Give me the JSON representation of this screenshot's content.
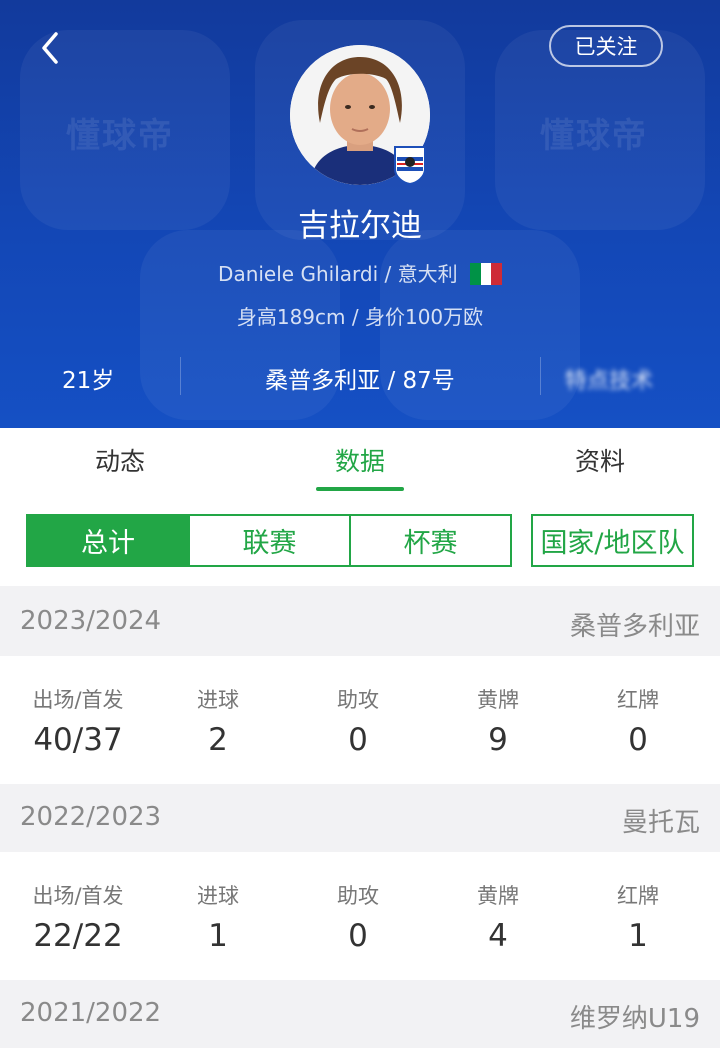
{
  "header": {
    "back_icon": "chevron-left-icon",
    "follow_label": "已关注",
    "watermark": "懂球帝",
    "player_name": "吉拉尔迪",
    "english_name": "Daniele Ghilardi",
    "nationality": "意大利",
    "flag_colors": [
      "#009246",
      "#ffffff",
      "#ce2b37"
    ],
    "height_value": "身高189cm / 身价100万欧",
    "age": "21岁",
    "club_number": "桑普多利亚 / 87号",
    "blurred_info": "特点技术"
  },
  "tabs": [
    {
      "label": "动态"
    },
    {
      "label": "数据",
      "active": true
    },
    {
      "label": "资料"
    }
  ],
  "segments": [
    {
      "label": "总计",
      "active": true
    },
    {
      "label": "联赛"
    },
    {
      "label": "杯赛"
    },
    {
      "label": "国家/地区队"
    }
  ],
  "stat_labels": [
    "出场/首发",
    "进球",
    "助攻",
    "黄牌",
    "红牌"
  ],
  "seasons": [
    {
      "year": "2023/2024",
      "team": "桑普多利亚",
      "values": [
        "40/37",
        "2",
        "0",
        "9",
        "0"
      ]
    },
    {
      "year": "2022/2023",
      "team": "曼托瓦",
      "values": [
        "22/22",
        "1",
        "0",
        "4",
        "1"
      ]
    },
    {
      "year": "2021/2022",
      "team": "维罗纳U19"
    }
  ],
  "colors": {
    "primary_blue": "#1347b6",
    "accent_green": "#22a646"
  }
}
